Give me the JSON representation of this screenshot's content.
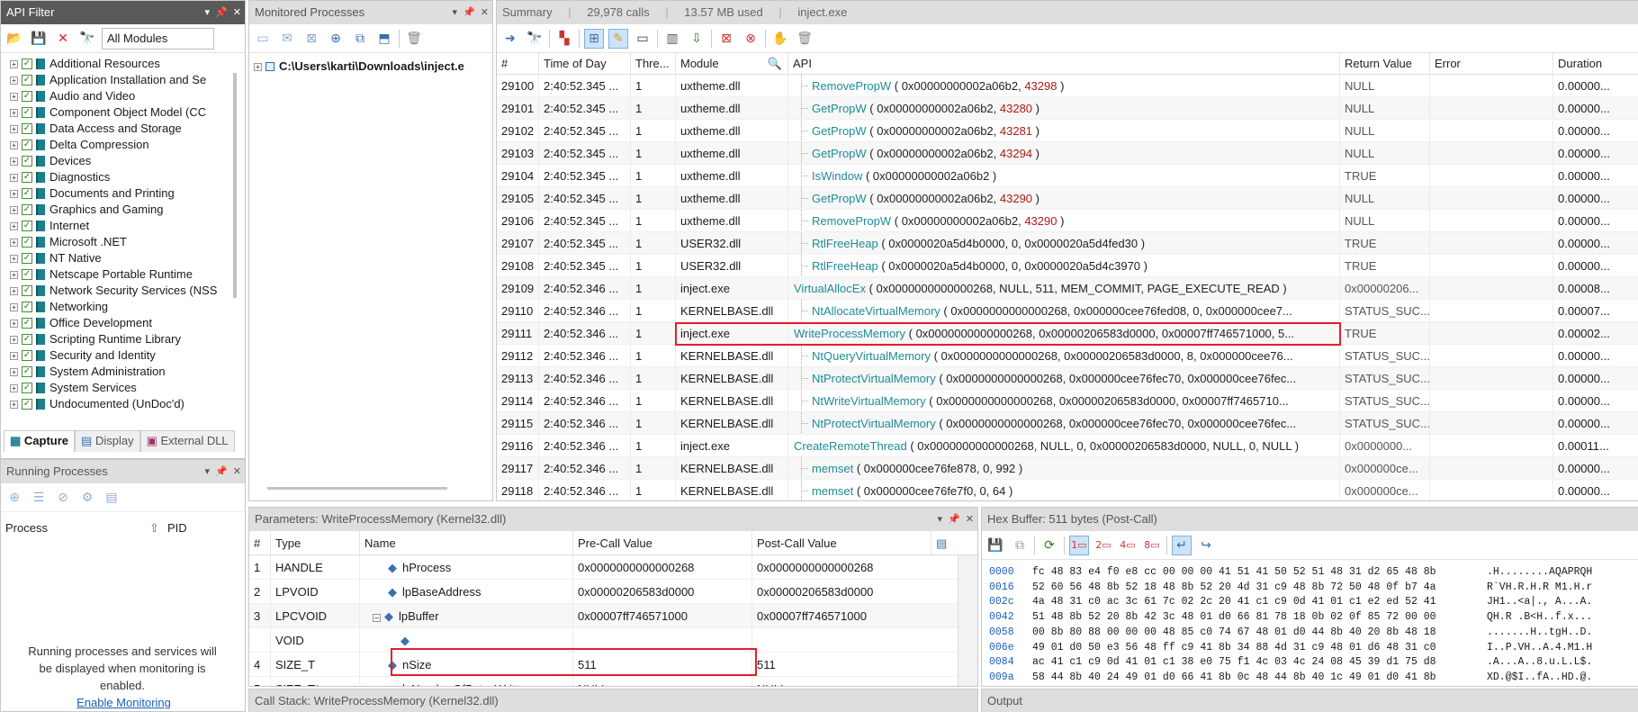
{
  "api_filter": {
    "title": "API Filter",
    "module_select": "All Modules",
    "items": [
      "Additional Resources",
      "Application Installation and Se",
      "Audio and Video",
      "Component Object Model (CC",
      "Data Access and Storage",
      "Delta Compression",
      "Devices",
      "Diagnostics",
      "Documents and Printing",
      "Graphics and Gaming",
      "Internet",
      "Microsoft .NET",
      "NT Native",
      "Netscape Portable Runtime",
      "Network Security Services (NSS",
      "Networking",
      "Office Development",
      "Scripting Runtime Library",
      "Security and Identity",
      "System Administration",
      "System Services",
      "Undocumented (UnDoc'd)"
    ],
    "tabs": [
      "Capture",
      "Display",
      "External DLL"
    ]
  },
  "running": {
    "title": "Running Processes",
    "col_process": "Process",
    "col_pid": "PID",
    "empty_msg": "Running processes and services will be displayed when monitoring is enabled.",
    "link": "Enable Monitoring"
  },
  "monitored": {
    "title": "Monitored Processes",
    "path": "C:\\Users\\karti\\Downloads\\inject.e"
  },
  "summary": {
    "title": "Summary",
    "calls": "29,978 calls",
    "mem": "13.57 MB used",
    "proc": "inject.exe"
  },
  "grid": {
    "cols": [
      "#",
      "Time of Day",
      "Thre...",
      "Module",
      "API",
      "Return Value",
      "Error",
      "Duration"
    ],
    "rows": [
      {
        "n": "29100",
        "t": "2:40:52.345 ...",
        "th": "1",
        "m": "uxtheme.dll",
        "api": "RemovePropW",
        "args": " ( 0x00000000002a06b2, ",
        "red": "43298",
        "tail": " )",
        "ret": "NULL",
        "dur": "0.00000...",
        "indent": true
      },
      {
        "n": "29101",
        "t": "2:40:52.345 ...",
        "th": "1",
        "m": "uxtheme.dll",
        "api": "GetPropW",
        "args": " ( 0x00000000002a06b2, ",
        "red": "43280",
        "tail": " )",
        "ret": "NULL",
        "dur": "0.00000...",
        "indent": true
      },
      {
        "n": "29102",
        "t": "2:40:52.345 ...",
        "th": "1",
        "m": "uxtheme.dll",
        "api": "GetPropW",
        "args": " ( 0x00000000002a06b2, ",
        "red": "43281",
        "tail": " )",
        "ret": "NULL",
        "dur": "0.00000...",
        "indent": true
      },
      {
        "n": "29103",
        "t": "2:40:52.345 ...",
        "th": "1",
        "m": "uxtheme.dll",
        "api": "GetPropW",
        "args": " ( 0x00000000002a06b2, ",
        "red": "43294",
        "tail": " )",
        "ret": "NULL",
        "dur": "0.00000...",
        "indent": true
      },
      {
        "n": "29104",
        "t": "2:40:52.345 ...",
        "th": "1",
        "m": "uxtheme.dll",
        "api": "IsWindow",
        "args": " ( 0x00000000002a06b2 )",
        "red": "",
        "tail": "",
        "ret": "TRUE",
        "dur": "0.00000...",
        "indent": true
      },
      {
        "n": "29105",
        "t": "2:40:52.345 ...",
        "th": "1",
        "m": "uxtheme.dll",
        "api": "GetPropW",
        "args": " ( 0x00000000002a06b2, ",
        "red": "43290",
        "tail": " )",
        "ret": "NULL",
        "dur": "0.00000...",
        "indent": true
      },
      {
        "n": "29106",
        "t": "2:40:52.345 ...",
        "th": "1",
        "m": "uxtheme.dll",
        "api": "RemovePropW",
        "args": " ( 0x00000000002a06b2, ",
        "red": "43290",
        "tail": " )",
        "ret": "NULL",
        "dur": "0.00000...",
        "indent": true
      },
      {
        "n": "29107",
        "t": "2:40:52.345 ...",
        "th": "1",
        "m": "USER32.dll",
        "api": "RtlFreeHeap",
        "args": " ( 0x0000020a5d4b0000, 0, 0x0000020a5d4fed30 )",
        "red": "",
        "tail": "",
        "ret": "TRUE",
        "dur": "0.00000...",
        "indent": true
      },
      {
        "n": "29108",
        "t": "2:40:52.345 ...",
        "th": "1",
        "m": "USER32.dll",
        "api": "RtlFreeHeap",
        "args": " ( 0x0000020a5d4b0000, 0, 0x0000020a5d4c3970 )",
        "red": "",
        "tail": "",
        "ret": "TRUE",
        "dur": "0.00000...",
        "indent": true
      },
      {
        "n": "29109",
        "t": "2:40:52.346 ...",
        "th": "1",
        "m": "inject.exe",
        "api": "VirtualAllocEx",
        "args": " ( 0x0000000000000268, NULL, 511, MEM_COMMIT, PAGE_EXECUTE_READ )",
        "red": "",
        "tail": "",
        "ret": "0x00000206...",
        "dur": "0.00008...",
        "indent": false
      },
      {
        "n": "29110",
        "t": "2:40:52.346 ...",
        "th": "1",
        "m": "KERNELBASE.dll",
        "api": "NtAllocateVirtualMemory",
        "args": " ( 0x0000000000000268, 0x000000cee76fed08, 0, 0x000000cee7...",
        "red": "",
        "tail": "",
        "ret": "STATUS_SUC...",
        "dur": "0.00007...",
        "indent": true
      },
      {
        "n": "29111",
        "t": "2:40:52.346 ...",
        "th": "1",
        "m": "inject.exe",
        "api": "WriteProcessMemory",
        "args": " ( 0x0000000000000268, 0x00000206583d0000, 0x00007ff746571000, 5...",
        "red": "",
        "tail": "",
        "ret": "TRUE",
        "dur": "0.00002...",
        "indent": false
      },
      {
        "n": "29112",
        "t": "2:40:52.346 ...",
        "th": "1",
        "m": "KERNELBASE.dll",
        "api": "NtQueryVirtualMemory",
        "args": " ( 0x0000000000000268, 0x00000206583d0000, 8, 0x000000cee76...",
        "red": "",
        "tail": "",
        "ret": "STATUS_SUC...",
        "dur": "0.00000...",
        "indent": true
      },
      {
        "n": "29113",
        "t": "2:40:52.346 ...",
        "th": "1",
        "m": "KERNELBASE.dll",
        "api": "NtProtectVirtualMemory",
        "args": " ( 0x0000000000000268, 0x000000cee76fec70, 0x000000cee76fec...",
        "red": "",
        "tail": "",
        "ret": "STATUS_SUC...",
        "dur": "0.00000...",
        "indent": true
      },
      {
        "n": "29114",
        "t": "2:40:52.346 ...",
        "th": "1",
        "m": "KERNELBASE.dll",
        "api": "NtWriteVirtualMemory",
        "args": " ( 0x0000000000000268, 0x00000206583d0000, 0x00007ff7465710...",
        "red": "",
        "tail": "",
        "ret": "STATUS_SUC...",
        "dur": "0.00000...",
        "indent": true
      },
      {
        "n": "29115",
        "t": "2:40:52.346 ...",
        "th": "1",
        "m": "KERNELBASE.dll",
        "api": "NtProtectVirtualMemory",
        "args": " ( 0x0000000000000268, 0x000000cee76fec70, 0x000000cee76fec...",
        "red": "",
        "tail": "",
        "ret": "STATUS_SUC...",
        "dur": "0.00000...",
        "indent": true
      },
      {
        "n": "29116",
        "t": "2:40:52.346 ...",
        "th": "1",
        "m": "inject.exe",
        "api": "CreateRemoteThread",
        "args": " ( 0x0000000000000268, NULL, 0, 0x00000206583d0000, NULL, 0, NULL )",
        "red": "",
        "tail": "",
        "ret": "0x0000000...",
        "dur": "0.00011...",
        "indent": false
      },
      {
        "n": "29117",
        "t": "2:40:52.346 ...",
        "th": "1",
        "m": "KERNELBASE.dll",
        "api": "memset",
        "args": " ( 0x000000cee76fe878, 0, 992 )",
        "red": "",
        "tail": "",
        "ret": "0x000000ce...",
        "dur": "0.00000...",
        "indent": true
      },
      {
        "n": "29118",
        "t": "2:40:52.346 ...",
        "th": "1",
        "m": "KERNELBASE.dll",
        "api": "memset",
        "args": " ( 0x000000cee76fe7f0, 0, 64 )",
        "red": "",
        "tail": "",
        "ret": "0x000000ce...",
        "dur": "0.00000...",
        "indent": true
      }
    ]
  },
  "params": {
    "title": "Parameters: WriteProcessMemory (Kernel32.dll)",
    "cols": [
      "#",
      "Type",
      "Name",
      "Pre-Call Value",
      "Post-Call Value"
    ],
    "rows": [
      {
        "n": "1",
        "type": "HANDLE",
        "name": "hProcess",
        "pre": "0x0000000000000268",
        "post": "0x0000000000000268"
      },
      {
        "n": "2",
        "type": "LPVOID",
        "name": "lpBaseAddress",
        "pre": "0x00000206583d0000",
        "post": "0x00000206583d0000"
      },
      {
        "n": "3",
        "type": "LPCVOID",
        "name": "lpBuffer",
        "pre": "0x00007ff746571000",
        "post": "0x00007ff746571000"
      },
      {
        "n": "",
        "type": "VOID",
        "name": "",
        "pre": "",
        "post": ""
      },
      {
        "n": "4",
        "type": "SIZE_T",
        "name": "nSize",
        "pre": "511",
        "post": "511"
      },
      {
        "n": "5",
        "type": "SIZE_T*",
        "name": "lpNumberOfBytesWritten",
        "pre": "NULL",
        "post": "NULL"
      }
    ]
  },
  "hex": {
    "title": "Hex Buffer: 511 bytes (Post-Call)",
    "lines": [
      {
        "off": "0000",
        "bytes": "fc 48 83 e4 f0 e8 cc 00 00 00 41 51 41 50 52 51 48 31 d2 65 48 8b",
        "ascii": ".H........AQAPRQH"
      },
      {
        "off": "0016",
        "bytes": "52 60 56 48 8b 52 18 48 8b 52 20 4d 31 c9 48 8b 72 50 48 0f b7 4a",
        "ascii": "R`VH.R.H.R M1.H.r"
      },
      {
        "off": "002c",
        "bytes": "4a 48 31 c0 ac 3c 61 7c 02 2c 20 41 c1 c9 0d 41 01 c1 e2 ed 52 41",
        "ascii": "JH1..<a|., A...A."
      },
      {
        "off": "0042",
        "bytes": "51 48 8b 52 20 8b 42 3c 48 01 d0 66 81 78 18 0b 02 0f 85 72 00 00",
        "ascii": "QH.R .B<H..f.x..."
      },
      {
        "off": "0058",
        "bytes": "00 8b 80 88 00 00 00 48 85 c0 74 67 48 01 d0 44 8b 40 20 8b 48 18",
        "ascii": ".......H..tgH..D."
      },
      {
        "off": "006e",
        "bytes": "49 01 d0 50 e3 56 48 ff c9 41 8b 34 88 4d 31 c9 48 01 d6 48 31 c0",
        "ascii": "I..P.VH..A.4.M1.H"
      },
      {
        "off": "0084",
        "bytes": "ac 41 c1 c9 0d 41 01 c1 38 e0 75 f1 4c 03 4c 24 08 45 39 d1 75 d8",
        "ascii": ".A...A..8.u.L.L$."
      },
      {
        "off": "009a",
        "bytes": "58 44 8b 40 24 49 01 d0 66 41 8b 0c 48 44 8b 40 1c 49 01 d0 41 8b",
        "ascii": "XD.@$I..fA..HD.@."
      }
    ]
  },
  "callstack": {
    "title": "Call Stack: WriteProcessMemory (Kernel32.dll)"
  },
  "output": {
    "title": "Output"
  }
}
